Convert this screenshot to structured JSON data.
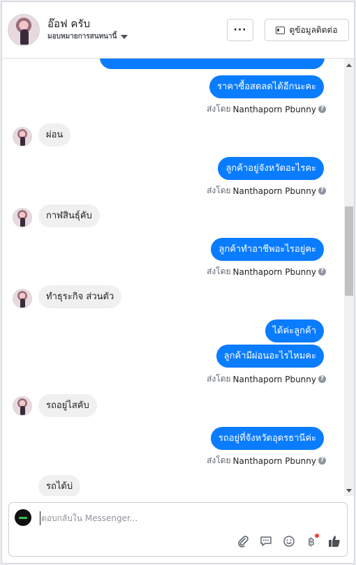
{
  "header": {
    "name": "อ๊อฟ ครับ",
    "subtitle": "มอบหมายการสนทนานี้",
    "more_label": "···",
    "contact_label": "ดูข้อมูลติดต่อ"
  },
  "messages": [
    {
      "type": "out",
      "text": "ราคาซื้อสดลดได้อีกนะคะ"
    },
    {
      "type": "sentby",
      "prefix": "ส่งโดย",
      "name": "Nanthaporn Pbunny"
    },
    {
      "type": "in",
      "text": "ผ่อน"
    },
    {
      "type": "out",
      "text": "ลูกค้าอยู่จังหวัดอะไรคะ"
    },
    {
      "type": "sentby",
      "prefix": "ส่งโดย",
      "name": "Nanthaporn Pbunny"
    },
    {
      "type": "in",
      "text": "กาฬสินธุ์คับ"
    },
    {
      "type": "out",
      "text": "ลูกค้าทำอาชีพอะไรอยู่คะ"
    },
    {
      "type": "sentby",
      "prefix": "ส่งโดย",
      "name": "Nanthaporn Pbunny"
    },
    {
      "type": "in",
      "text": "ทำธุระกิจ ส่วนตัว"
    },
    {
      "type": "out",
      "text": "ได้ค่ะลูกค้า"
    },
    {
      "type": "out",
      "text": "ลูกค้ามีผ่อนอะไรไหมคะ"
    },
    {
      "type": "sentby",
      "prefix": "ส่งโดย",
      "name": "Nanthaporn Pbunny"
    },
    {
      "type": "in",
      "text": "รถอยู่ไสคับ"
    },
    {
      "type": "out",
      "text": "รถอยู่ที่จังหวัดอุดรธานีค่ะ"
    },
    {
      "type": "sentby",
      "prefix": "ส่งโดย",
      "name": "Nanthaporn Pbunny"
    },
    {
      "type": "in",
      "text": "รถได้บ่"
    }
  ],
  "composer": {
    "placeholder": "ตอบกลับใน Messenger..."
  },
  "icons": {
    "attach": "paperclip-icon",
    "sticker": "chat-bubble-icon",
    "emoji": "smiley-icon",
    "payment": "baht-icon",
    "like": "thumbs-up-icon"
  },
  "colors": {
    "outgoing_bubble": "#0a7cff",
    "incoming_bubble": "#f1f0f0",
    "notification_dot": "#fa3e3e"
  }
}
